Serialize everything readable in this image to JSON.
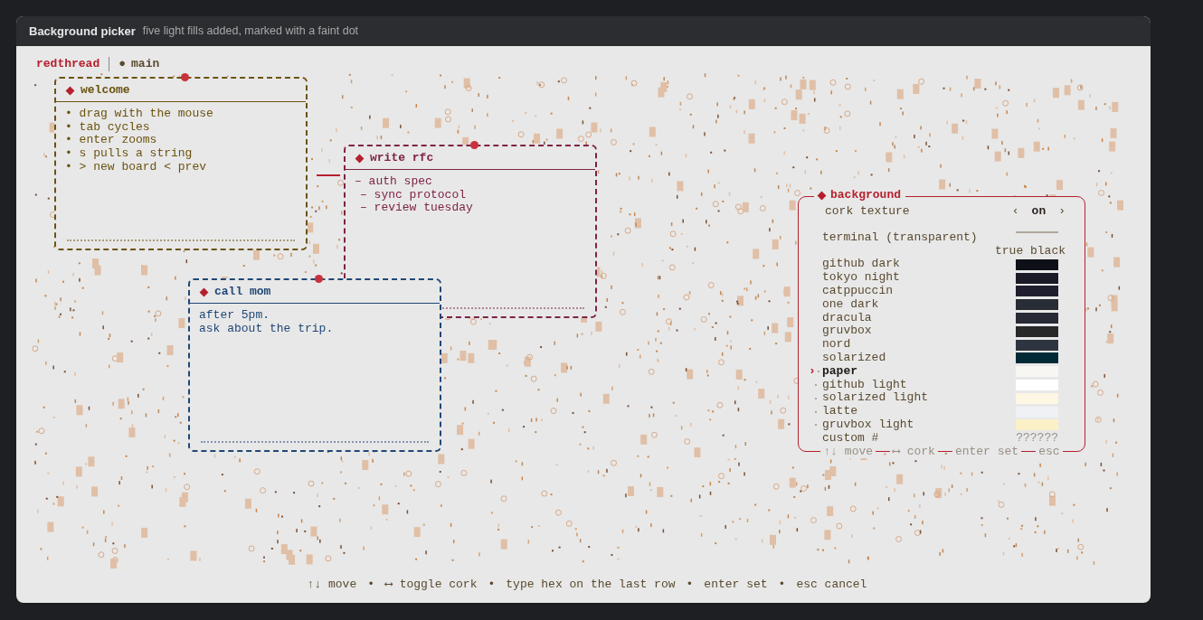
{
  "window": {
    "title": "Background picker",
    "subtitle": "five light fills added, marked with a faint dot"
  },
  "header": {
    "app": "redthread",
    "branch_mark": "●",
    "branch": "main"
  },
  "boards": [
    {
      "title": "welcome",
      "color": "#6b5310",
      "lines": [
        "• drag with the mouse",
        "• tab cycles",
        "• enter zooms",
        "• s pulls a string",
        "• > new board < prev"
      ]
    },
    {
      "title": "write rfc",
      "color": "#7e2346",
      "lines": [
        "– auth spec",
        "– sync protocol",
        "– review tuesday"
      ]
    },
    {
      "title": "call mom",
      "color": "#1f4777",
      "lines": [
        "after 5pm.",
        "ask about the trip."
      ]
    }
  ],
  "picker": {
    "title": "background",
    "selection_caret": "›",
    "cork": {
      "label": "cork texture",
      "prev": "‹",
      "value": "on",
      "next": "›",
      "on": true
    },
    "items": [
      {
        "name": "terminal (transparent)",
        "kind": "transparent",
        "selected": false,
        "light": false
      },
      {
        "name": "true black",
        "kind": "shifted",
        "selected": false,
        "light": false
      },
      {
        "name": "github dark",
        "kind": "swatch",
        "color": "#0d1117",
        "selected": false,
        "light": false
      },
      {
        "name": "tokyo night",
        "kind": "swatch",
        "color": "#1a1b26",
        "selected": false,
        "light": false
      },
      {
        "name": "catppuccin",
        "kind": "swatch",
        "color": "#1e1e2e",
        "selected": false,
        "light": false
      },
      {
        "name": "one dark",
        "kind": "swatch",
        "color": "#282c34",
        "selected": false,
        "light": false
      },
      {
        "name": "dracula",
        "kind": "swatch",
        "color": "#282a36",
        "selected": false,
        "light": false
      },
      {
        "name": "gruvbox",
        "kind": "swatch",
        "color": "#282828",
        "selected": false,
        "light": false
      },
      {
        "name": "nord",
        "kind": "swatch",
        "color": "#2e3440",
        "selected": false,
        "light": false
      },
      {
        "name": "solarized",
        "kind": "swatch",
        "color": "#002b36",
        "selected": false,
        "light": false
      },
      {
        "name": "paper",
        "kind": "swatch",
        "color": "#f7f6f2",
        "selected": true,
        "light": true
      },
      {
        "name": "github light",
        "kind": "swatch",
        "color": "#ffffff",
        "selected": false,
        "light": true
      },
      {
        "name": "solarized light",
        "kind": "swatch",
        "color": "#fdf6e3",
        "selected": false,
        "light": true
      },
      {
        "name": "latte",
        "kind": "swatch",
        "color": "#eff1f5",
        "selected": false,
        "light": true
      },
      {
        "name": "gruvbox light",
        "kind": "swatch",
        "color": "#fbf1c7",
        "selected": false,
        "light": true
      },
      {
        "name": "custom #",
        "kind": "custom",
        "value": "??????",
        "selected": false,
        "light": false
      }
    ],
    "hints": [
      "↑↓ move",
      "⟷ cork",
      "enter set",
      "esc"
    ]
  },
  "hints": [
    {
      "text": "↑↓ move"
    },
    {
      "text": "•"
    },
    {
      "text": "⟷ toggle cork"
    },
    {
      "text": "•"
    },
    {
      "text": "type hex on the last row"
    },
    {
      "text": "•"
    },
    {
      "text": "enter set"
    },
    {
      "text": "•"
    },
    {
      "text": "esc cancel"
    }
  ]
}
